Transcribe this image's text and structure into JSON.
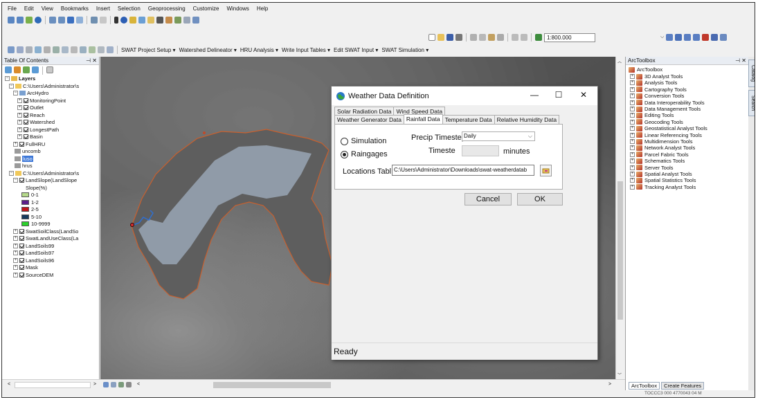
{
  "menu": [
    "File",
    "Edit",
    "View",
    "Bookmarks",
    "Insert",
    "Selection",
    "Geoprocessing",
    "Customize",
    "Windows",
    "Help"
  ],
  "toolbar": {
    "scale": "1:800.000"
  },
  "swat_menu": [
    "SWAT Project Setup ▾",
    "Watershed Delineator ▾",
    "HRU Analysis ▾",
    "Write Input Tables ▾",
    "Edit SWAT Input ▾",
    "SWAT Simulation ▾"
  ],
  "toc": {
    "title": "Table Of Contents",
    "pin": "⊣ ✕",
    "rows": [
      {
        "indent": 0,
        "exp": "⊟",
        "label": "Layers",
        "bold": true,
        "icon": "layers-icon"
      },
      {
        "indent": 6,
        "exp": "⊟",
        "label": "C:\\Users\\Administrator\\s",
        "icon": "folder-icon"
      },
      {
        "indent": 12,
        "exp": "⊟",
        "label": "ArcHydro",
        "icon": "group-icon"
      },
      {
        "indent": 18,
        "exp": "⊞",
        "check": true,
        "label": "MonitoringPoint"
      },
      {
        "indent": 18,
        "exp": "⊞",
        "check": true,
        "label": "Outlet"
      },
      {
        "indent": 18,
        "exp": "⊞",
        "check": true,
        "label": "Reach"
      },
      {
        "indent": 18,
        "exp": "⊞",
        "check": true,
        "label": "Watershed"
      },
      {
        "indent": 18,
        "exp": "⊞",
        "check": true,
        "label": "LongestPath"
      },
      {
        "indent": 18,
        "exp": "⊞",
        "check": true,
        "label": "Basin"
      },
      {
        "indent": 12,
        "exp": "⊞",
        "check": true,
        "label": "FullHRU"
      },
      {
        "indent": 14,
        "label": "uncomb",
        "icon": "table-icon"
      },
      {
        "indent": 14,
        "label": "luso",
        "icon": "table-icon",
        "selected": true
      },
      {
        "indent": 14,
        "label": "hrus",
        "icon": "table-icon"
      },
      {
        "indent": 6,
        "exp": "⊟",
        "label": "C:\\Users\\Administrator\\s",
        "icon": "folder-icon"
      },
      {
        "indent": 12,
        "exp": "⊟",
        "check": true,
        "label": "LandSlope(LandSlope"
      },
      {
        "indent": 30,
        "label": "Slope(%)"
      },
      {
        "indent": 24,
        "swatch": "#b5d98a",
        "label": "0-1"
      },
      {
        "indent": 24,
        "swatch": "#5b1f8a",
        "label": "1-2"
      },
      {
        "indent": 24,
        "swatch": "#c0161a",
        "label": "2-5"
      },
      {
        "indent": 24,
        "swatch": "#163a5c",
        "label": "5-10"
      },
      {
        "indent": 24,
        "swatch": "#2bd12b",
        "label": "10-9999"
      },
      {
        "indent": 12,
        "exp": "⊞",
        "check": true,
        "label": "SwatSoilClass(LandSo"
      },
      {
        "indent": 12,
        "exp": "⊞",
        "check": true,
        "label": "SwatLandUseClass(La"
      },
      {
        "indent": 12,
        "exp": "⊞",
        "check": true,
        "label": "LandSoils99"
      },
      {
        "indent": 12,
        "exp": "⊞",
        "check": true,
        "label": "LandSoils97"
      },
      {
        "indent": 12,
        "exp": "⊞",
        "check": true,
        "label": "LandSoils96"
      },
      {
        "indent": 12,
        "exp": "⊞",
        "check": true,
        "label": "Mask"
      },
      {
        "indent": 12,
        "exp": "⊞",
        "check": true,
        "label": "SourceDEM"
      }
    ]
  },
  "arctoolbox": {
    "title": "ArcToolbox",
    "pin": "⊣ ✕",
    "root": "ArcToolbox",
    "tools": [
      "3D Analyst Tools",
      "Analysis Tools",
      "Cartography Tools",
      "Conversion Tools",
      "Data Interoperability Tools",
      "Data Management Tools",
      "Editing Tools",
      "Geocoding Tools",
      "Geostatistical Analyst Tools",
      "Linear Referencing Tools",
      "Multidimension Tools",
      "Network Analyst Tools",
      "Parcel Fabric Tools",
      "Schematics Tools",
      "Server Tools",
      "Spatial Analyst Tools",
      "Spatial Statistics Tools",
      "Tracking Analyst Tools"
    ],
    "bottom_tabs": [
      "ArcToolbox",
      "Create Features"
    ]
  },
  "sidetabs": [
    "Catalog",
    "Search"
  ],
  "bottom": {
    "coords": "TOCCC3 000 4770043 04 M"
  },
  "dialog": {
    "title": "Weather Data Definition",
    "min": "—",
    "max": "☐",
    "close": "✕",
    "tabs_row1": [
      "Solar Radiation Data",
      "Wind Speed Data"
    ],
    "tabs_row2": [
      "Weather Generator Data",
      "Rainfall Data",
      "Temperature Data",
      "Relative Humidity Data"
    ],
    "active_tab": "Rainfall Data",
    "simulation_label": "Simulation",
    "raingages_label": "Raingages",
    "precip_label": "Precip Timestep",
    "precip_value": "Daily",
    "timestep_label": "Timeste",
    "timestep_value": "",
    "minutes_label": "minutes",
    "locations_label": "Locations Tabl",
    "locations_value": "C:\\Users\\Administrator\\Downloads\\swat-weatherdatab",
    "cancel_label": "Cancel",
    "ok_label": "OK",
    "status": "Ready"
  }
}
